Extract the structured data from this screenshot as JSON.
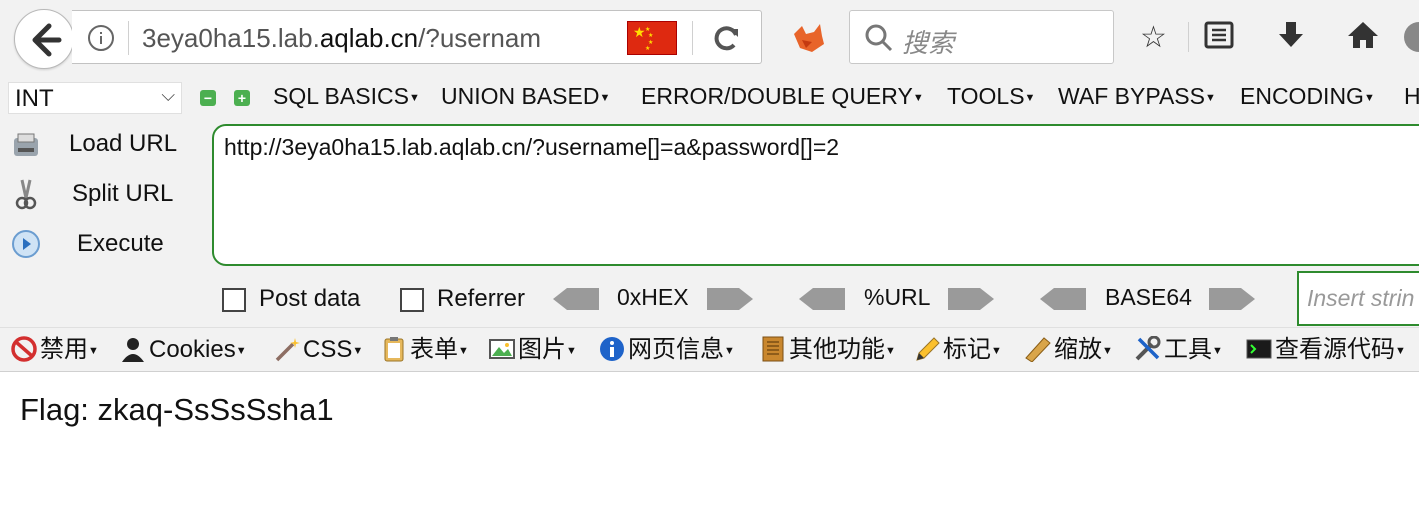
{
  "browser": {
    "url_prefix": "3eya0ha15.lab.",
    "url_domain": "aqlab.cn",
    "url_suffix": "/?usernam",
    "search_placeholder": "搜索"
  },
  "hackbar": {
    "select_value": "INT",
    "menus": [
      "SQL BASICS",
      "UNION BASED",
      "ERROR/DOUBLE QUERY",
      "TOOLS",
      "WAF BYPASS",
      "ENCODING",
      "H"
    ],
    "load_url": "Load URL",
    "split_url": "Split URL",
    "execute": "Execute",
    "url_value": "http://3eya0ha15.lab.aqlab.cn/?username[]=a&password[]=2",
    "post_data": "Post data",
    "referrer": "Referrer",
    "hex": "0xHEX",
    "url_enc": "%URL",
    "base64": "BASE64",
    "insert_placeholder": "Insert strin"
  },
  "webdev": {
    "items": [
      "禁用",
      "Cookies",
      "CSS",
      "表单",
      "图片",
      "网页信息",
      "其他功能",
      "标记",
      "缩放",
      "工具",
      "查看源代码"
    ]
  },
  "page": {
    "content": "Flag: zkaq-SsSsSsha1"
  },
  "colors": {
    "accent_green": "#2e8b2e",
    "flag_red": "#de2910"
  }
}
